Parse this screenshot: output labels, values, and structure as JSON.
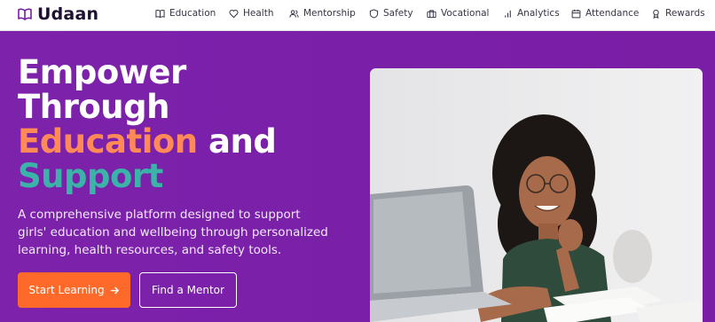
{
  "brand": {
    "name": "Udaan",
    "icon": "book-open-icon"
  },
  "nav": {
    "items": [
      {
        "label": "Education",
        "icon": "book-icon"
      },
      {
        "label": "Health",
        "icon": "heart-icon"
      },
      {
        "label": "Mentorship",
        "icon": "users-icon"
      },
      {
        "label": "Safety",
        "icon": "shield-icon"
      },
      {
        "label": "Vocational",
        "icon": "briefcase-icon"
      },
      {
        "label": "Analytics",
        "icon": "bar-chart-icon"
      },
      {
        "label": "Attendance",
        "icon": "calendar-icon"
      },
      {
        "label": "Rewards",
        "icon": "award-icon"
      }
    ]
  },
  "hero": {
    "headline_1": "Empower",
    "headline_2": "Through",
    "headline_3_highlight": "Education",
    "headline_3_rest": " and",
    "headline_4_highlight": "Support",
    "subtext": "A comprehensive platform designed to support girls' education and wellbeing through personalized learning, health resources, and safety tools.",
    "primary_button": "Start Learning",
    "secondary_button": "Find a Mentor"
  },
  "colors": {
    "hero_bg": "#7a1fa8",
    "accent_orange": "#ff8a57",
    "accent_teal": "#3bb3a8",
    "button_primary": "#ff6a2a",
    "brand_icon": "#7a1fa8"
  }
}
